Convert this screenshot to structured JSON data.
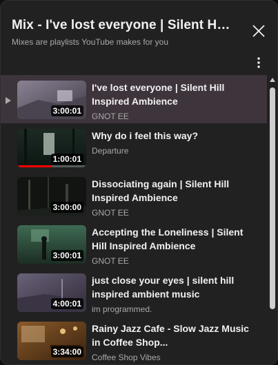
{
  "header": {
    "title": "Mix - I've lost everyone | Silent Hill...",
    "subtitle": "Mixes are playlists YouTube makes for you"
  },
  "icons": {
    "close": "close-icon",
    "more": "more-vert-icon",
    "playing": "play-indicator-icon"
  },
  "colors": {
    "active_row": "#3e343c",
    "progress": "#ff0000",
    "background": "#212121"
  },
  "items": [
    {
      "title": "I've lost everyone | Silent Hill Inspired Ambience",
      "channel": "GNOT EE",
      "duration": "3:00:01",
      "active": true,
      "progress": 0
    },
    {
      "title": "Why do i feel this way?",
      "channel": "Departure",
      "duration": "1:00:01",
      "active": false,
      "progress": 0.5
    },
    {
      "title": "Dissociating again | Silent Hill Inspired Ambience",
      "channel": "GNOT EE",
      "duration": "3:00:00",
      "active": false,
      "progress": 0
    },
    {
      "title": "Accepting the Loneliness | Silent Hill Inspired Ambience",
      "channel": "GNOT EE",
      "duration": "3:00:01",
      "active": false,
      "progress": 0
    },
    {
      "title": "just close your eyes | silent hill inspired ambient music",
      "channel": "im programmed.",
      "duration": "4:00:01",
      "active": false,
      "progress": 0
    },
    {
      "title": "Rainy Jazz Cafe - Slow Jazz Music in Coffee Shop...",
      "channel": "Coffee Shop Vibes",
      "duration": "3:34:00",
      "active": false,
      "progress": 0
    }
  ]
}
